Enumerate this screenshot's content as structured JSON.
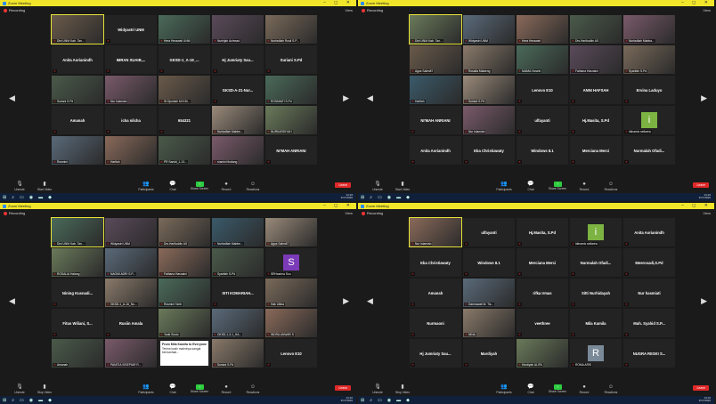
{
  "window": {
    "title": "Zoom Meeting",
    "recording": "Recording",
    "view": "View"
  },
  "toolbar": {
    "unmute": "Unmute",
    "video": "Start Video",
    "video2": "Stop Video",
    "participants": "Participants",
    "chat": "Chat",
    "share": "Share Screen",
    "record": "Record",
    "reactions": "Reactions",
    "leave": "Leave",
    "count": "91"
  },
  "clock": {
    "time": "13:16",
    "date": "3/17/2020"
  },
  "pages": {
    "p1": "1/4",
    "p2": "2/4",
    "p3": "3/4"
  },
  "quads": [
    {
      "tiles": [
        [
          "ph",
          "Dini UNM Kab. Tan..."
        ],
        [
          "name",
          "Widyastri UNM"
        ],
        [
          "ph",
          "Hera Herawati UNM"
        ],
        [
          "ph",
          "Nurhijah Achmad"
        ],
        [
          "ph",
          "Nurfadilah Rusli S.P..."
        ],
        [
          "name",
          "Anita Aorianindh"
        ],
        [
          "name",
          "IMRAN SUAIB,..."
        ],
        [
          "name",
          "GKSD-1_A-19_..."
        ],
        [
          "name",
          "Hj Jumriaty Sau..."
        ],
        [
          "name",
          "Suriani S.Pd"
        ],
        [
          "ph",
          "Suriani S.Pd"
        ],
        [
          "ph",
          "Nur Islamiah"
        ],
        [
          "ph",
          "St Djumlah MI KM..."
        ],
        [
          "name",
          "GKSD-A-21-Nur..."
        ],
        [
          "ph",
          "ROSMIATI S.Pd"
        ],
        [
          "name",
          "Amanah"
        ],
        [
          "name",
          "icha nilcha"
        ],
        [
          "name",
          "654321"
        ],
        [
          "ph",
          "Nurfadilah Mabbe..."
        ],
        [
          "ph",
          "NURKARDIYAH"
        ],
        [
          "ph",
          "Rosmini"
        ],
        [
          "ph",
          "Harfiah"
        ],
        [
          "ph",
          "PR Sanidi_1-13..."
        ],
        [
          "ph",
          "rosmini thalang"
        ],
        [
          "name",
          "NI'MAH ANRIANI"
        ]
      ]
    },
    {
      "tiles": [
        [
          "ph",
          "Dini UNM Kab. Tan..."
        ],
        [
          "ph",
          "Widyastri UNM"
        ],
        [
          "ph",
          "Hera Herawati"
        ],
        [
          "ph",
          "Drs.Harifuddin AS"
        ],
        [
          "ph",
          "Nurfadilah Mabba..."
        ],
        [
          "ph",
          "Agus Salim87"
        ],
        [
          "ph",
          "Rosalia Malaeng"
        ],
        [
          "ph",
          "NAIMA Hosein"
        ],
        [
          "ph",
          "Fathana Hasnaini"
        ],
        [
          "ph",
          "Syarifah S.Pd"
        ],
        [
          "ph",
          "Harfiah"
        ],
        [
          "ph",
          "Suriani S.Pd"
        ],
        [
          "name",
          "Lenovo E10"
        ],
        [
          "name",
          "ANNI HAFSAH"
        ],
        [
          "name",
          "Ervina Laduyo"
        ],
        [
          "name",
          "NI'MAH ANRIANI"
        ],
        [
          "ph",
          "Nur Islamiah"
        ],
        [
          "name",
          "ulfayanti"
        ],
        [
          "name",
          "Hj.Masita, S.Pd"
        ],
        [
          "av",
          "i",
          "#7cb342",
          "Idinamic sellarea"
        ],
        [
          "name",
          "Anita Aorianindh"
        ],
        [
          "name",
          "Eba Christiawaty"
        ],
        [
          "name",
          "Windows 8.1"
        ],
        [
          "name",
          "Merciana Merci"
        ],
        [
          "name",
          "Nurmalah Ofadi..."
        ]
      ]
    },
    {
      "tiles": [
        [
          "ph",
          "Dini UNM Kab. Tan..."
        ],
        [
          "ph",
          "Widyastri UNM"
        ],
        [
          "ph",
          "Drs.Harifuddin AS"
        ],
        [
          "ph",
          "Nurfadilah Mabbe..."
        ],
        [
          "ph",
          "Agus Salim87"
        ],
        [
          "ph",
          "ROSALIA Halang"
        ],
        [
          "ph",
          "NAOMI ADRI S.P..."
        ],
        [
          "ph",
          "Fathana Hasnaini"
        ],
        [
          "ph",
          "Syarifah S.Pd"
        ],
        [
          "av",
          "S",
          "#7b3ab7",
          "SRHasrina Sou"
        ],
        [
          "name",
          "Nining Kusnadi..."
        ],
        [
          "ph",
          "GKSD-1_A-16_Nu..."
        ],
        [
          "ph",
          "Rosmini Tarib"
        ],
        [
          "name",
          "SITI KOMARIAH..."
        ],
        [
          "ph",
          "Hak Uliida"
        ],
        [
          "name",
          "Fitus Wiliani, S..."
        ],
        [
          "name",
          "Rusiin Amala"
        ],
        [
          "ph",
          "Yanti Sindo"
        ],
        [
          "ph",
          "GKSD-1-3-1_HA..."
        ],
        [
          "ph",
          "INDRA ANWAR S"
        ],
        [
          "ph",
          "Amanah"
        ],
        [
          "ph",
          "PANITIA SISEPIAR R..."
        ],
        [
          "chat",
          "From Mila Kamila to Everyone",
          "Terima kasih materinya sangat bermanfaat..."
        ],
        [
          "ph",
          "Suriani S.Pd"
        ],
        [
          "name",
          "Lenovo E10"
        ]
      ]
    },
    {
      "tiles": [
        [
          "ph",
          "Nur Islamiah"
        ],
        [
          "name",
          "ulfayanti"
        ],
        [
          "name",
          "Hj.Masita, S.Pd"
        ],
        [
          "av",
          "i",
          "#7cb342",
          "Idinamic sellarea"
        ],
        [
          "name",
          "Anita Aorianindh"
        ],
        [
          "name",
          "Eba Christiawaty"
        ],
        [
          "name",
          "Windows 8.1"
        ],
        [
          "name",
          "Merciana Merci"
        ],
        [
          "name",
          "Nurmalah Ofadi..."
        ],
        [
          "name",
          "Meerosadi,S.Pd"
        ],
        [
          "name",
          "Amanah"
        ],
        [
          "ph",
          "Darmawati M. Tis..."
        ],
        [
          "name",
          "rifka Irmas"
        ],
        [
          "name",
          "Sitti Nurhidayah"
        ],
        [
          "name",
          "Nur hasmiati"
        ],
        [
          "name",
          "Nurmaoni"
        ],
        [
          "ph",
          "NINA"
        ],
        [
          "name",
          "veethree"
        ],
        [
          "name",
          "Mila Kamila"
        ],
        [
          "name",
          "Muh. Syahid S.P..."
        ],
        [
          "name",
          "Hj Jumriaty Sau..."
        ],
        [
          "name",
          "Mardiyah"
        ],
        [
          "ph",
          "Hurdiyah ALIFA"
        ],
        [
          "av",
          "R",
          "#7a8a99",
          "ROMA ARIS"
        ],
        [
          "name",
          "NUGRA RESKI S..."
        ]
      ]
    }
  ]
}
